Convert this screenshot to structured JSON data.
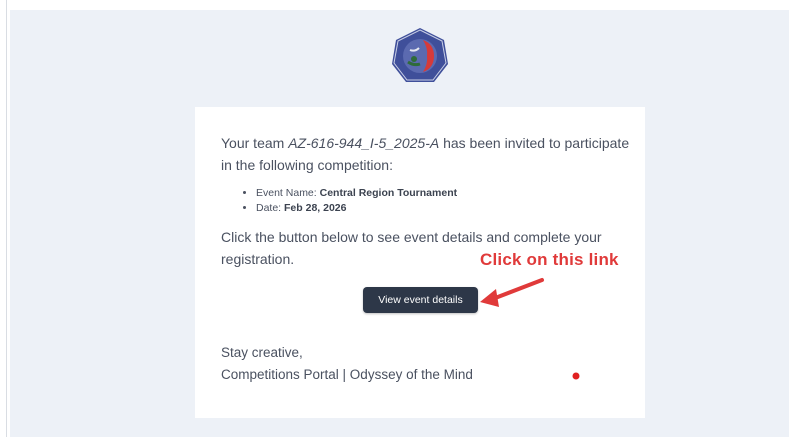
{
  "email": {
    "logo_icon": "odyssey-of-the-mind-logo",
    "invite": {
      "prefix": "Your team ",
      "team_code": "AZ-616-944_I-5_2025-A",
      "suffix": " has been invited to participate in the following competition:"
    },
    "details": [
      {
        "label": "Event Name: ",
        "value": "Central Region Tournament"
      },
      {
        "label": "Date: ",
        "value": "Feb 28, 2026"
      }
    ],
    "cta_text": "Click the button below to see event details and complete your registration.",
    "button_label": "View event details",
    "signoff": "Stay creative,",
    "signature": "Competitions Portal | Odyssey of the Mind"
  },
  "annotation": {
    "text": "Click on this link",
    "color": "#e03a3a"
  },
  "colors": {
    "background": "#edf1f7",
    "card": "#ffffff",
    "button": "#2d3748",
    "text": "#4a5160"
  }
}
